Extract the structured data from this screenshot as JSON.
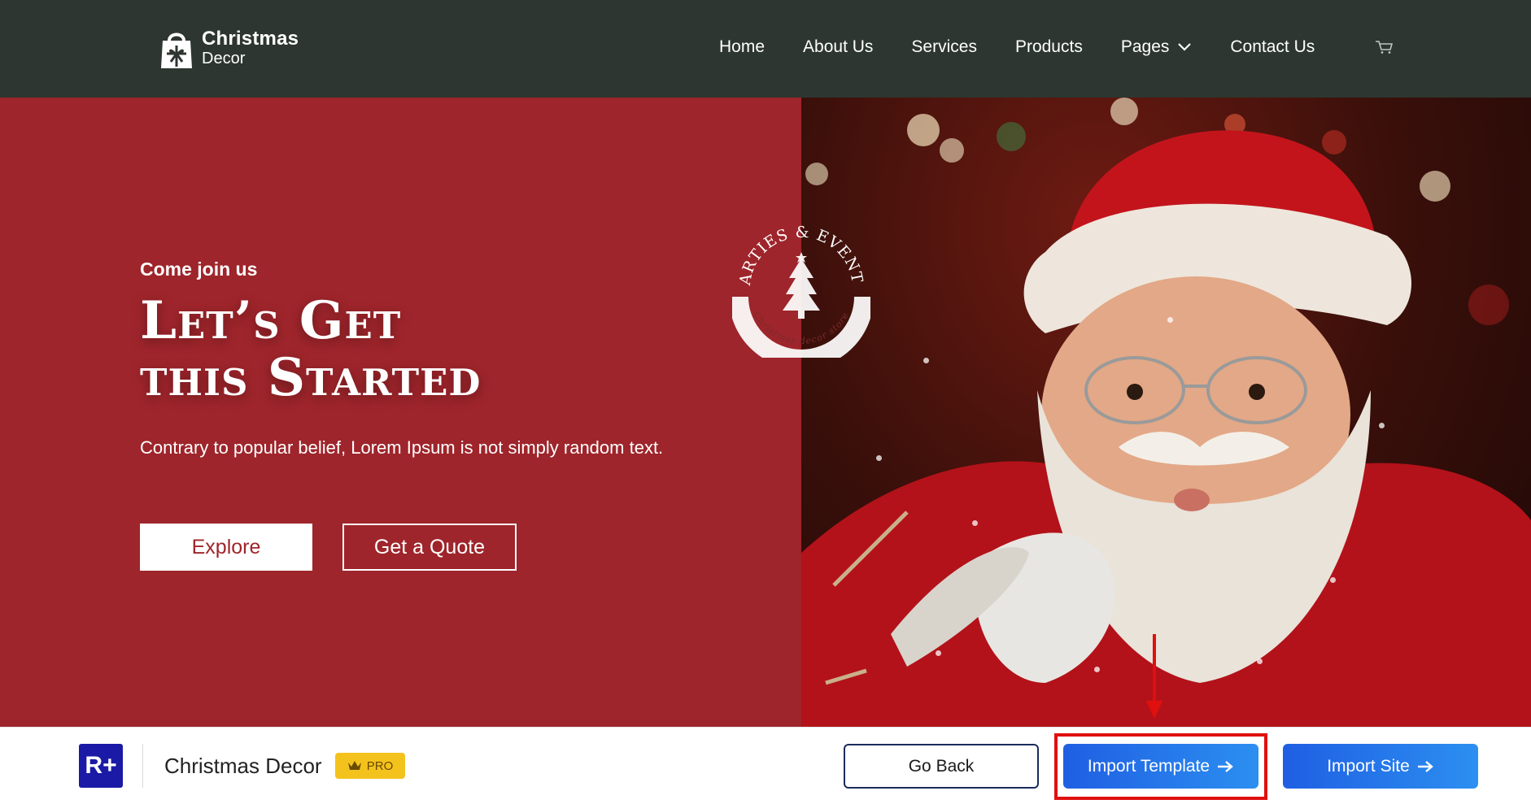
{
  "header": {
    "logo": {
      "title": "Christmas",
      "subtitle": "Decor",
      "icon": "gift-bag-icon"
    },
    "nav": [
      {
        "label": "Home"
      },
      {
        "label": "About Us"
      },
      {
        "label": "Services"
      },
      {
        "label": "Products"
      },
      {
        "label": "Pages",
        "has_dropdown": true
      },
      {
        "label": "Contact Us"
      }
    ],
    "cart_icon": "cart-icon"
  },
  "hero": {
    "kicker": "Come join us",
    "headline_line1": "Let’s Get",
    "headline_line2": "this Started",
    "lead": "Contrary to popular belief, Lorem Ipsum is not simply random text.",
    "explore_label": "Explore",
    "quote_label": "Get a Quote",
    "seal": {
      "top_text": "PARTIES & EVENTS",
      "bottom_text": "Christmas decor store",
      "icon": "christmas-tree-icon"
    },
    "colors": {
      "panel": "#9e252b",
      "header": "#2d3630"
    }
  },
  "bottom_bar": {
    "brand_logo": "R+",
    "template_name": "Christmas Decor",
    "badge": "PRO",
    "go_back_label": "Go Back",
    "import_template_label": "Import Template",
    "import_site_label": "Import Site",
    "accent": "#1f5fe3"
  },
  "annotation": {
    "highlight_color": "#e0100f"
  }
}
